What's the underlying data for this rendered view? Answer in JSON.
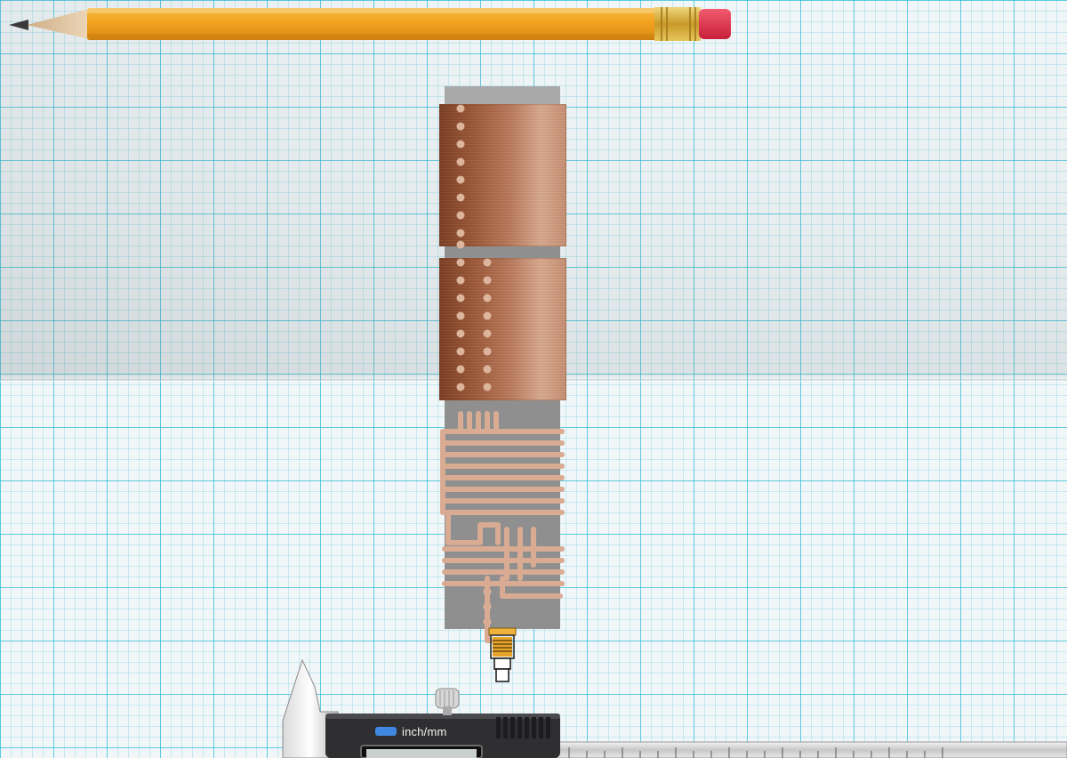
{
  "caliper": {
    "button_label": "inch/mm"
  },
  "colors": {
    "pencil_body": "#f2a21f",
    "pencil_ferrule": "#d6b23a",
    "eraser": "#e4324a",
    "copper_dark": "#7c3f24",
    "copper_light": "#d8a98e",
    "board_gray": "#8f8f8f",
    "grid_line": "#26bad6"
  },
  "icons": [
    "pencil-icon",
    "pcb-module-icon",
    "sma-connector-icon",
    "digital-caliper-icon"
  ]
}
